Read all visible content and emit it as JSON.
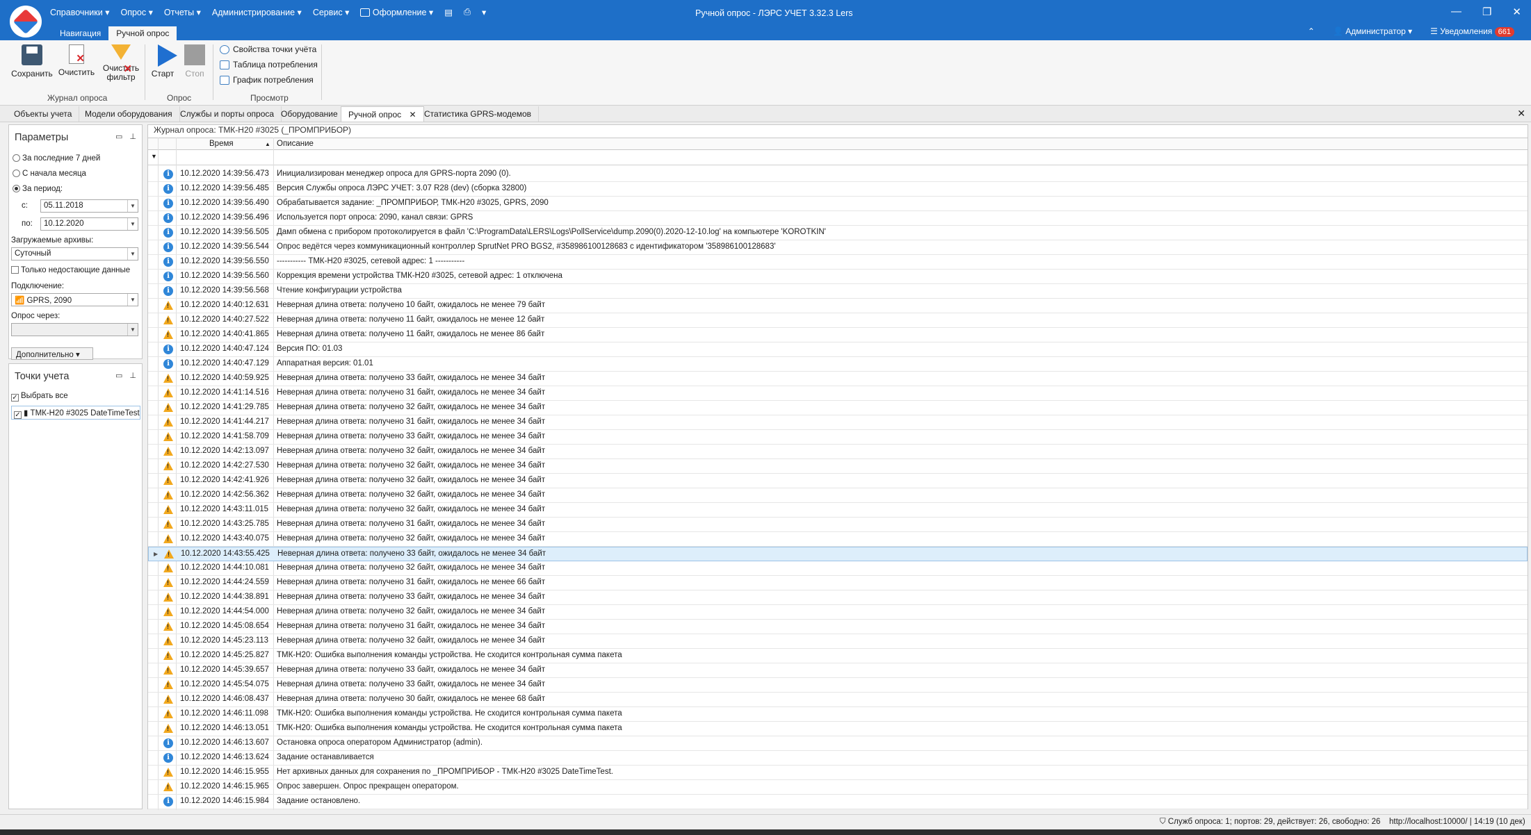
{
  "app": {
    "window_title": "Ручной опрос - ЛЭРС УЧЕТ 3.32.3 Lers",
    "menu": [
      "Справочники ▾",
      "Опрос ▾",
      "Отчеты ▾",
      "Администрирование ▾",
      "Сервис ▾",
      "Оформление ▾"
    ],
    "ribbon_tabs": [
      "Навигация",
      "Ручной опрос"
    ],
    "user": "Администратор ▾",
    "notifications_label": "Уведомления",
    "notifications_count": "661",
    "collapse_glyph": "⌃",
    "close_glyph": "✕",
    "minimize_glyph": "—",
    "restore_glyph": "❐"
  },
  "ribbon": {
    "save": "Сохранить",
    "clear": "Очистить",
    "clear_filter_1": "Очистить",
    "clear_filter_2": "фильтр",
    "group_journal": "Журнал опроса",
    "start": "Старт",
    "stop": "Стоп",
    "group_poll": "Опрос",
    "view_props": "Свойства точки учёта",
    "view_table": "Таблица потребления",
    "view_graph": "График потребления",
    "group_view": "Просмотр"
  },
  "doc_tabs": [
    "Объекты учета",
    "Модели оборудования",
    "Службы и порты опроса",
    "Оборудование",
    "Ручной опрос",
    "Статистика GPRS-модемов"
  ],
  "params": {
    "title": "Параметры",
    "last7": "За последние 7 дней",
    "month_start": "С начала месяца",
    "period": "За период:",
    "from_label": "с:",
    "from_value": "05.11.2018",
    "to_label": "по:",
    "to_value": "10.12.2020",
    "archives_label": "Загружаемые архивы:",
    "archives_value": "Суточный",
    "missing_only": "Только недостающие данные",
    "connection_label": "Подключение:",
    "connection_value": "GPRS, 2090",
    "via_label": "Опрос через:",
    "more_button": "Дополнительно ▾"
  },
  "points": {
    "title": "Точки учета",
    "select_all": "Выбрать все",
    "item": "ТМК-Н20 #3025 DateTimeTest"
  },
  "journal": {
    "title": "Журнал опроса: ТМК-Н20 #3025 (_ПРОМПРИБОР)",
    "col_time": "Время",
    "col_desc": "Описание",
    "rows": [
      {
        "t": "i",
        "time": "10.12.2020 14:39:56.473",
        "desc": "Инициализирован менеджер опроса для GPRS-порта 2090 (0)."
      },
      {
        "t": "i",
        "time": "10.12.2020 14:39:56.485",
        "desc": "Версия Службы опроса ЛЭРС УЧЕТ: 3.07 R28 (dev) (сборка 32800)"
      },
      {
        "t": "i",
        "time": "10.12.2020 14:39:56.490",
        "desc": "Обрабатывается задание: _ПРОМПРИБОР, ТМК-Н20 #3025, GPRS, 2090"
      },
      {
        "t": "i",
        "time": "10.12.2020 14:39:56.496",
        "desc": "Используется порт опроса: 2090, канал связи: GPRS"
      },
      {
        "t": "i",
        "time": "10.12.2020 14:39:56.505",
        "desc": "Дамп обмена с прибором протоколируется в файл 'C:\\ProgramData\\LERS\\Logs\\PollService\\dump.2090(0).2020-12-10.log' на компьютере 'KOROTKIN'"
      },
      {
        "t": "i",
        "time": "10.12.2020 14:39:56.544",
        "desc": "Опрос ведётся через коммуникационный контроллер SprutNet PRO BGS2, #358986100128683 с идентификатором '358986100128683'"
      },
      {
        "t": "i",
        "time": "10.12.2020 14:39:56.550",
        "desc": "----------- ТМК-Н20 #3025, сетевой адрес: 1 -----------"
      },
      {
        "t": "i",
        "time": "10.12.2020 14:39:56.560",
        "desc": "Коррекция времени устройства ТМК-Н20 #3025, сетевой адрес: 1 отключена"
      },
      {
        "t": "i",
        "time": "10.12.2020 14:39:56.568",
        "desc": "Чтение конфигурации устройства"
      },
      {
        "t": "w",
        "time": "10.12.2020 14:40:12.631",
        "desc": "Неверная длина ответа: получено 10 байт, ожидалось не менее 79 байт"
      },
      {
        "t": "w",
        "time": "10.12.2020 14:40:27.522",
        "desc": "Неверная длина ответа: получено 11 байт, ожидалось не менее 12 байт"
      },
      {
        "t": "w",
        "time": "10.12.2020 14:40:41.865",
        "desc": "Неверная длина ответа: получено 11 байт, ожидалось не менее 86 байт"
      },
      {
        "t": "i",
        "time": "10.12.2020 14:40:47.124",
        "desc": "Версия ПО: 01.03"
      },
      {
        "t": "i",
        "time": "10.12.2020 14:40:47.129",
        "desc": "Аппаратная версия: 01.01"
      },
      {
        "t": "w",
        "time": "10.12.2020 14:40:59.925",
        "desc": "Неверная длина ответа: получено 33 байт, ожидалось не менее 34 байт"
      },
      {
        "t": "w",
        "time": "10.12.2020 14:41:14.516",
        "desc": "Неверная длина ответа: получено 31 байт, ожидалось не менее 34 байт"
      },
      {
        "t": "w",
        "time": "10.12.2020 14:41:29.785",
        "desc": "Неверная длина ответа: получено 32 байт, ожидалось не менее 34 байт"
      },
      {
        "t": "w",
        "time": "10.12.2020 14:41:44.217",
        "desc": "Неверная длина ответа: получено 31 байт, ожидалось не менее 34 байт"
      },
      {
        "t": "w",
        "time": "10.12.2020 14:41:58.709",
        "desc": "Неверная длина ответа: получено 33 байт, ожидалось не менее 34 байт"
      },
      {
        "t": "w",
        "time": "10.12.2020 14:42:13.097",
        "desc": "Неверная длина ответа: получено 32 байт, ожидалось не менее 34 байт"
      },
      {
        "t": "w",
        "time": "10.12.2020 14:42:27.530",
        "desc": "Неверная длина ответа: получено 32 байт, ожидалось не менее 34 байт"
      },
      {
        "t": "w",
        "time": "10.12.2020 14:42:41.926",
        "desc": "Неверная длина ответа: получено 32 байт, ожидалось не менее 34 байт"
      },
      {
        "t": "w",
        "time": "10.12.2020 14:42:56.362",
        "desc": "Неверная длина ответа: получено 32 байт, ожидалось не менее 34 байт"
      },
      {
        "t": "w",
        "time": "10.12.2020 14:43:11.015",
        "desc": "Неверная длина ответа: получено 32 байт, ожидалось не менее 34 байт"
      },
      {
        "t": "w",
        "time": "10.12.2020 14:43:25.785",
        "desc": "Неверная длина ответа: получено 31 байт, ожидалось не менее 34 байт"
      },
      {
        "t": "w",
        "time": "10.12.2020 14:43:40.075",
        "desc": "Неверная длина ответа: получено 32 байт, ожидалось не менее 34 байт"
      },
      {
        "t": "w",
        "time": "10.12.2020 14:43:55.425",
        "desc": "Неверная длина ответа: получено 33 байт, ожидалось не менее 34 байт",
        "sel": true
      },
      {
        "t": "w",
        "time": "10.12.2020 14:44:10.081",
        "desc": "Неверная длина ответа: получено 32 байт, ожидалось не менее 34 байт"
      },
      {
        "t": "w",
        "time": "10.12.2020 14:44:24.559",
        "desc": "Неверная длина ответа: получено 31 байт, ожидалось не менее 66 байт"
      },
      {
        "t": "w",
        "time": "10.12.2020 14:44:38.891",
        "desc": "Неверная длина ответа: получено 33 байт, ожидалось не менее 34 байт"
      },
      {
        "t": "w",
        "time": "10.12.2020 14:44:54.000",
        "desc": "Неверная длина ответа: получено 32 байт, ожидалось не менее 34 байт"
      },
      {
        "t": "w",
        "time": "10.12.2020 14:45:08.654",
        "desc": "Неверная длина ответа: получено 31 байт, ожидалось не менее 34 байт"
      },
      {
        "t": "w",
        "time": "10.12.2020 14:45:23.113",
        "desc": "Неверная длина ответа: получено 32 байт, ожидалось не менее 34 байт"
      },
      {
        "t": "w",
        "time": "10.12.2020 14:45:25.827",
        "desc": "ТМК-Н20: Ошибка выполнения команды устройства. Не сходится контрольная сумма пакета"
      },
      {
        "t": "w",
        "time": "10.12.2020 14:45:39.657",
        "desc": "Неверная длина ответа: получено 33 байт, ожидалось не менее 34 байт"
      },
      {
        "t": "w",
        "time": "10.12.2020 14:45:54.075",
        "desc": "Неверная длина ответа: получено 33 байт, ожидалось не менее 34 байт"
      },
      {
        "t": "w",
        "time": "10.12.2020 14:46:08.437",
        "desc": "Неверная длина ответа: получено 30 байт, ожидалось не менее 68 байт"
      },
      {
        "t": "w",
        "time": "10.12.2020 14:46:11.098",
        "desc": "ТМК-Н20: Ошибка выполнения команды устройства. Не сходится контрольная сумма пакета"
      },
      {
        "t": "w",
        "time": "10.12.2020 14:46:13.051",
        "desc": "ТМК-Н20: Ошибка выполнения команды устройства. Не сходится контрольная сумма пакета"
      },
      {
        "t": "i",
        "time": "10.12.2020 14:46:13.607",
        "desc": "Остановка опроса оператором Администратор (admin)."
      },
      {
        "t": "i",
        "time": "10.12.2020 14:46:13.624",
        "desc": "Задание останавливается"
      },
      {
        "t": "w",
        "time": "10.12.2020 14:46:15.955",
        "desc": "Нет архивных данных для сохранения по _ПРОМПРИБОР - ТМК-Н20 #3025 DateTimeTest."
      },
      {
        "t": "w",
        "time": "10.12.2020 14:46:15.965",
        "desc": "Опрос завершен. Опрос прекращен оператором."
      },
      {
        "t": "i",
        "time": "10.12.2020 14:46:15.984",
        "desc": "Задание остановлено."
      }
    ]
  },
  "status": {
    "services": "Служб опроса: 1; портов: 29, действует: 26, свободно: 26",
    "server": "http://localhost:10000/ | 14:19 (10 дек)"
  }
}
